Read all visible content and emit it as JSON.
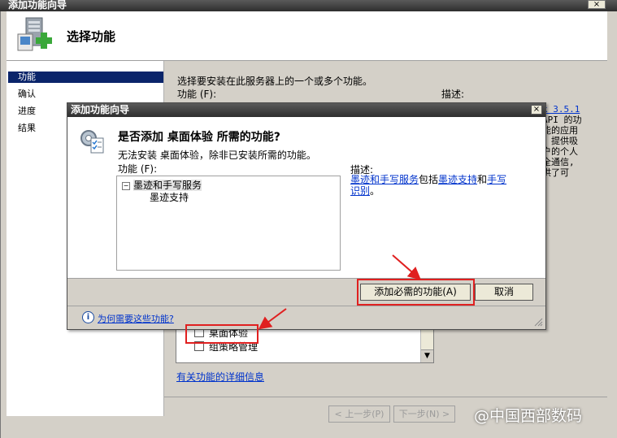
{
  "outer_window": {
    "title": "添加功能向导",
    "close_glyph": "×",
    "header_title": "选择功能",
    "steps": [
      {
        "label": "功能",
        "active": true
      },
      {
        "label": "确认",
        "active": false
      },
      {
        "label": "进度",
        "active": false
      },
      {
        "label": "结果",
        "active": false
      }
    ],
    "intro": "选择要安装在此服务器上的一个或多个功能。",
    "features_label": "功能 (F):",
    "description_label": "描述:",
    "description_fragment": {
      "link": "k 3.5.1",
      "lines": [
        "API 的功",
        "能的应用",
        "。提供吸",
        "户的个人",
        "全通信,",
        "供了可"
      ]
    },
    "feature_rows": [
      {
        "label": "桌面体验",
        "checked": false
      },
      {
        "label": "组策略管理",
        "checked": false
      }
    ],
    "scroll_down_glyph": "▼",
    "feature_info_link": "有关功能的详细信息",
    "buttons": {
      "previous": "< 上一步(P)",
      "next": "下一步(N) >"
    }
  },
  "dialog": {
    "title": "添加功能向导",
    "close_glyph": "×",
    "question": "是否添加 桌面体验 所需的功能?",
    "message": "无法安装 桌面体验，除非已安装所需的功能。",
    "features_label": "功能 (F):",
    "tree": {
      "toggle": "−",
      "parent": "墨迹和手写服务",
      "child": "墨迹支持"
    },
    "description_label": "描述:",
    "description": {
      "link1": "墨迹和手写服务",
      "text1": "包括",
      "link2": "墨迹支持",
      "text2": "和",
      "link3": "手写识别",
      "text3": "。"
    },
    "add_button": "添加必需的功能(A)",
    "cancel_button": "取消",
    "info_glyph": "i",
    "why_link": "为何需要这些功能?"
  },
  "watermark": "@中国西部数码",
  "colors": {
    "titlebar": "#3a3a3a",
    "selection": "#0a246a",
    "link": "#0033cc",
    "annotation": "#e02020"
  }
}
